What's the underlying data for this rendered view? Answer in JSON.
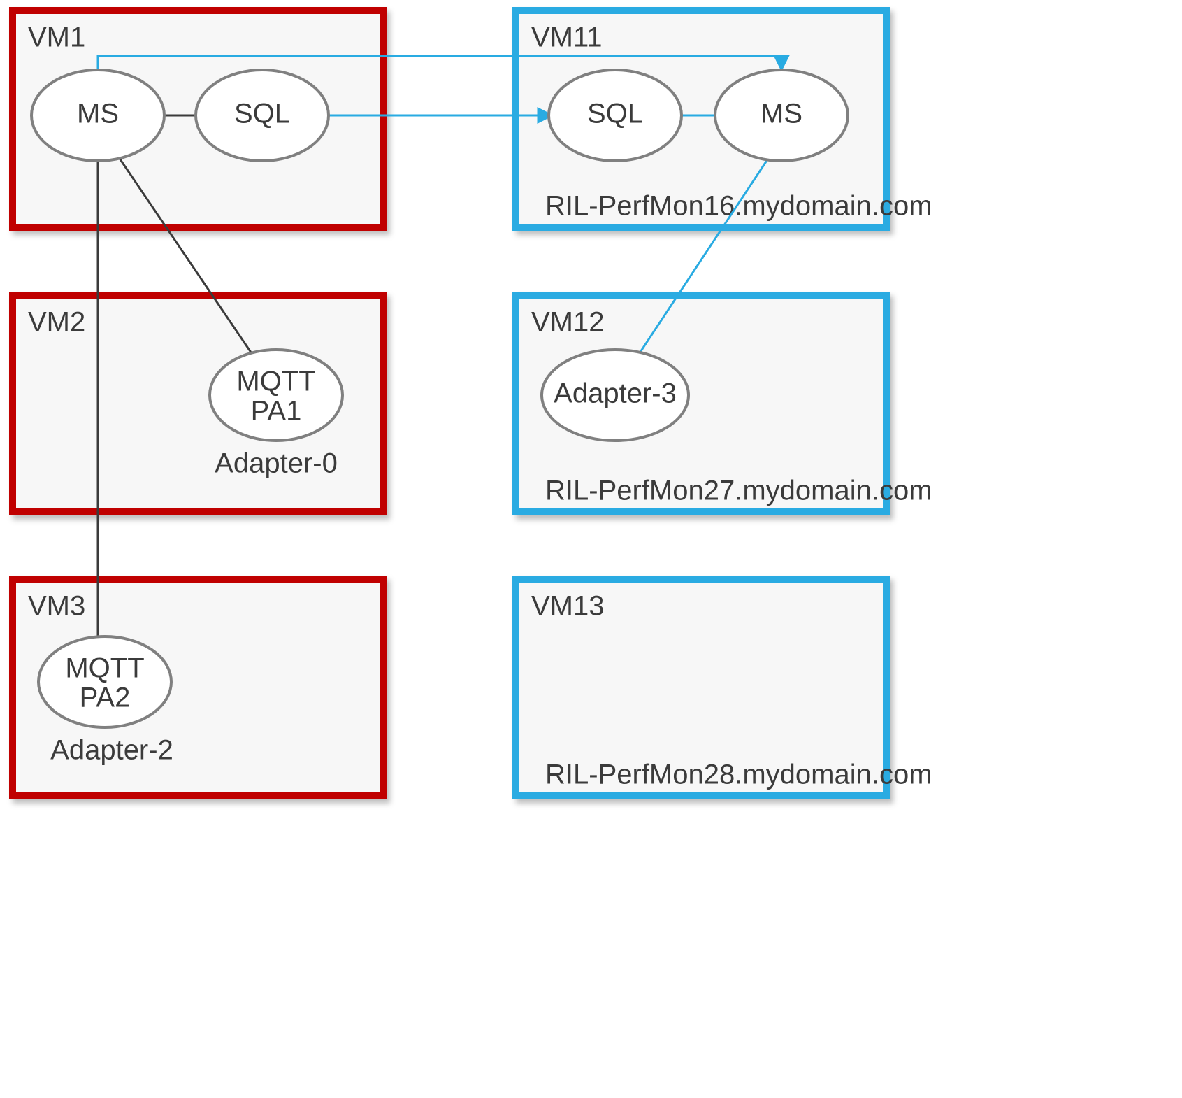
{
  "vm1": {
    "title": "VM1",
    "nodes": {
      "ms": "MS",
      "sql": "SQL"
    }
  },
  "vm2": {
    "title": "VM2",
    "nodes": {
      "mqtt_l1": "MQTT",
      "mqtt_l2": "PA1",
      "sublabel": "Adapter-0"
    }
  },
  "vm3": {
    "title": "VM3",
    "nodes": {
      "mqtt_l1": "MQTT",
      "mqtt_l2": "PA2",
      "sublabel": "Adapter-2"
    }
  },
  "vm11": {
    "title": "VM11",
    "nodes": {
      "sql": "SQL",
      "ms": "MS"
    },
    "host": "RIL-PerfMon16.mydomain.com"
  },
  "vm12": {
    "title": "VM12",
    "nodes": {
      "adapter": "Adapter-3"
    },
    "host": "RIL-PerfMon27.mydomain.com"
  },
  "vm13": {
    "title": "VM13",
    "host": "RIL-PerfMon28.mydomain.com"
  }
}
